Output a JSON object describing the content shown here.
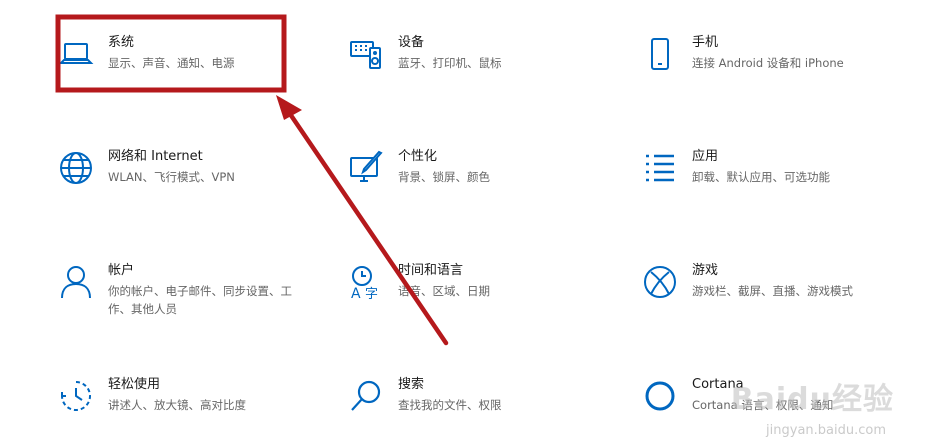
{
  "accent_color": "#0067c0",
  "annotation_color": "#b5191c",
  "tiles": [
    {
      "title": "系统",
      "desc": "显示、声音、通知、电源",
      "icon": "laptop-icon"
    },
    {
      "title": "设备",
      "desc": "蓝牙、打印机、鼠标",
      "icon": "keyboard-speaker-icon"
    },
    {
      "title": "手机",
      "desc": "连接 Android 设备和 iPhone",
      "icon": "phone-icon"
    },
    {
      "title": "网络和 Internet",
      "desc": "WLAN、飞行模式、VPN",
      "icon": "globe-icon"
    },
    {
      "title": "个性化",
      "desc": "背景、锁屏、颜色",
      "icon": "paint-brush-icon"
    },
    {
      "title": "应用",
      "desc": "卸载、默认应用、可选功能",
      "icon": "apps-list-icon"
    },
    {
      "title": "帐户",
      "desc": "你的帐户、电子邮件、同步设置、工作、其他人员",
      "icon": "person-icon"
    },
    {
      "title": "时间和语言",
      "desc": "语音、区域、日期",
      "icon": "time-language-icon"
    },
    {
      "title": "游戏",
      "desc": "游戏栏、截屏、直播、游戏模式",
      "icon": "xbox-icon"
    },
    {
      "title": "轻松使用",
      "desc": "讲述人、放大镜、高对比度",
      "icon": "ease-of-access-icon"
    },
    {
      "title": "搜索",
      "desc": "查找我的文件、权限",
      "icon": "search-icon"
    },
    {
      "title": "Cortana",
      "desc": "Cortana 语言、权限、通知",
      "icon": "cortana-icon"
    }
  ],
  "watermark": {
    "text": "Baidu经验",
    "sub": "jingyan.baidu.com"
  }
}
